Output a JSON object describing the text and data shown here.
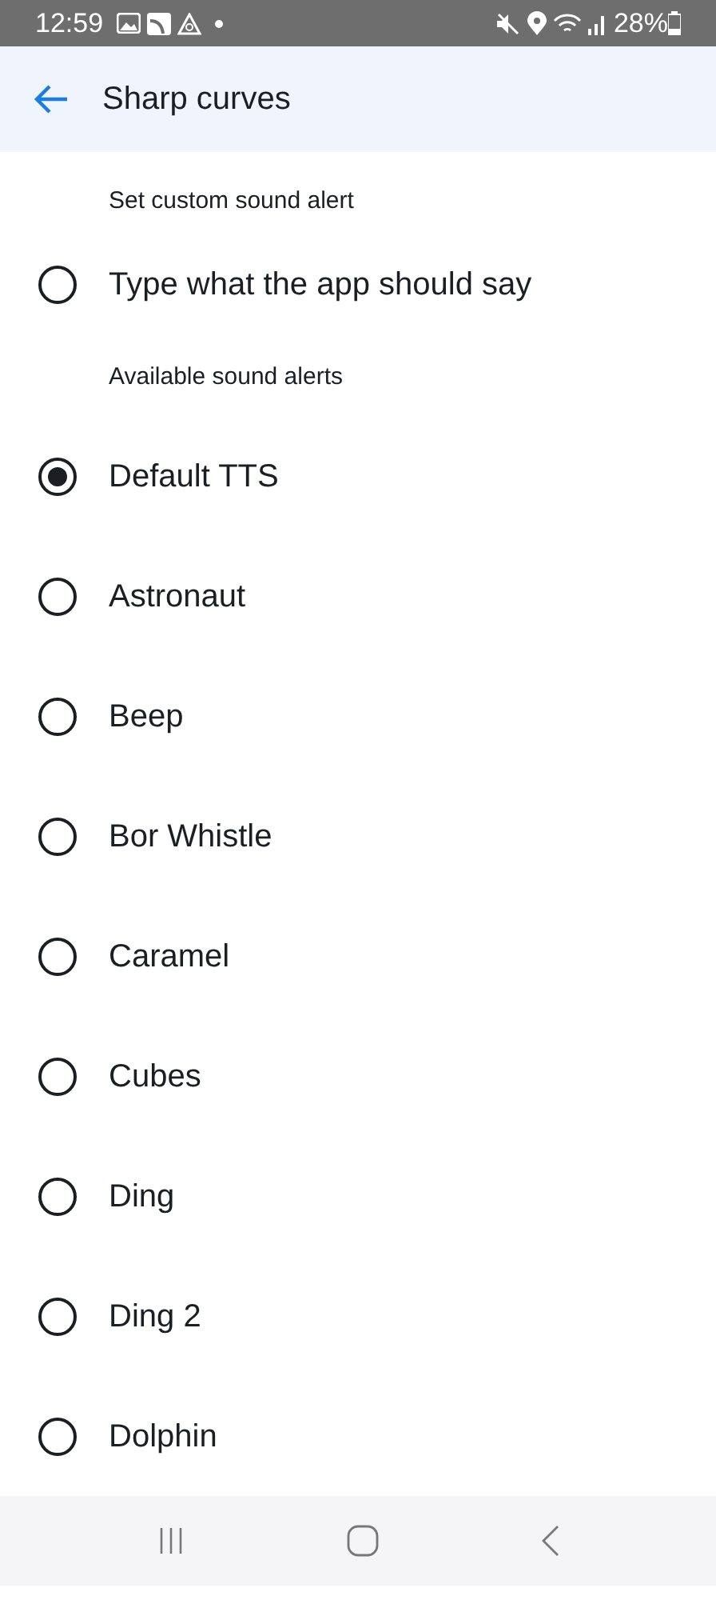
{
  "status_bar": {
    "time": "12:59",
    "battery": "28%"
  },
  "header": {
    "title": "Sharp curves"
  },
  "sections": [
    {
      "label": "Set custom sound alert",
      "options": [
        {
          "label": "Type what the app should say",
          "selected": false
        }
      ]
    },
    {
      "label": "Available sound alerts",
      "options": [
        {
          "label": "Default TTS",
          "selected": true
        },
        {
          "label": "Astronaut",
          "selected": false
        },
        {
          "label": "Beep",
          "selected": false
        },
        {
          "label": "Bor Whistle",
          "selected": false
        },
        {
          "label": "Caramel",
          "selected": false
        },
        {
          "label": "Cubes",
          "selected": false
        },
        {
          "label": "Ding",
          "selected": false
        },
        {
          "label": "Ding 2",
          "selected": false
        },
        {
          "label": "Dolphin",
          "selected": false
        }
      ]
    }
  ]
}
